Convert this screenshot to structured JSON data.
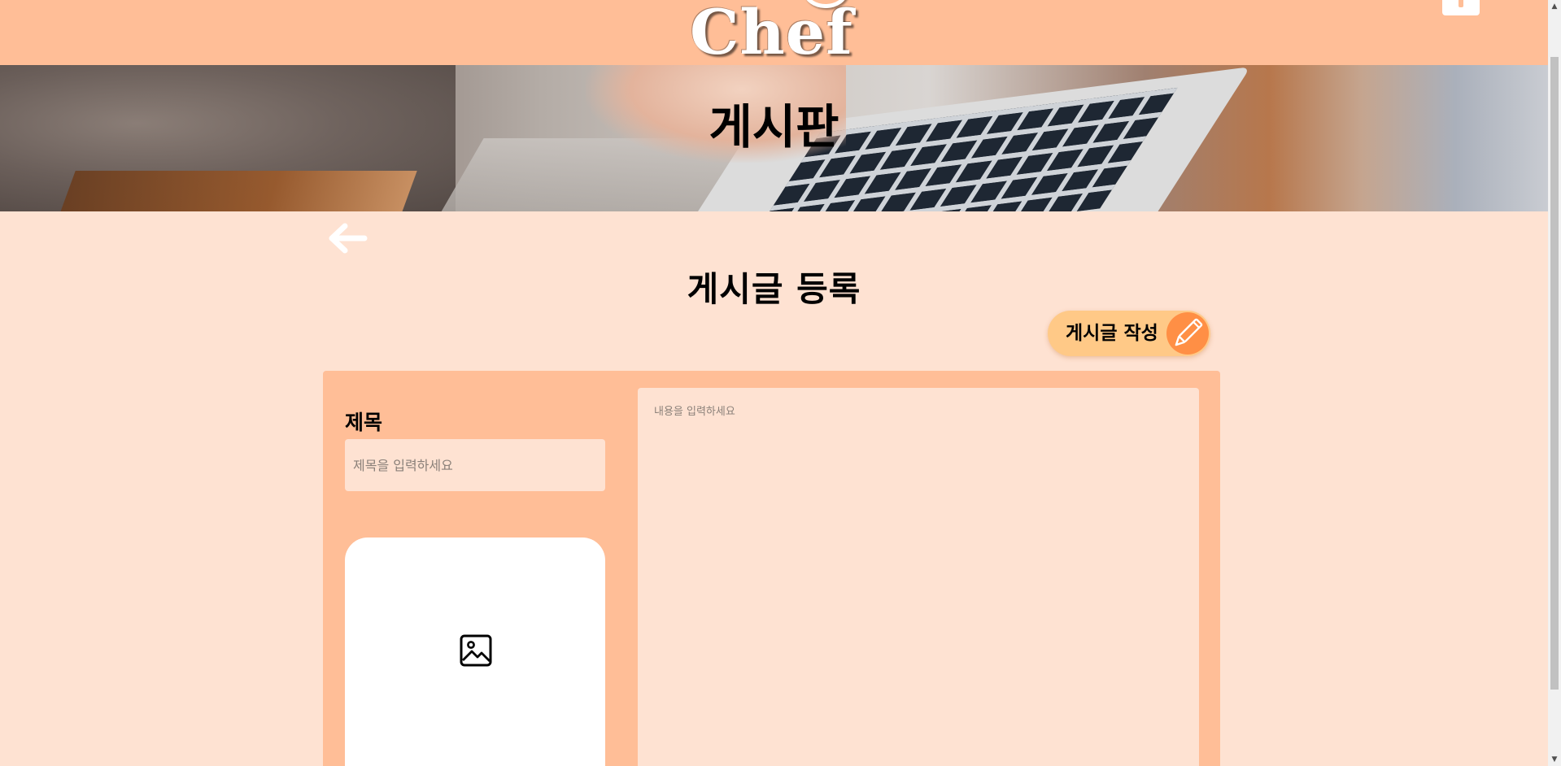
{
  "header": {
    "logo_text": "Chef",
    "menu_icon": "menu-icon"
  },
  "hero": {
    "title": "게시판"
  },
  "nav": {
    "back_icon": "arrow-left-icon"
  },
  "main": {
    "title": "게시글 등록",
    "write_button_label": "게시글 작성",
    "write_button_icon": "pencil-icon"
  },
  "form": {
    "title_label": "제목",
    "title_placeholder": "제목을 입력하세요",
    "content_placeholder": "내용을 입력하세요",
    "image_icon": "image-icon"
  },
  "colors": {
    "header_bg": "#ffbe97",
    "page_bg": "#fee2d2",
    "button_bg": "#ffc987",
    "button_accent": "#ff8f45"
  }
}
